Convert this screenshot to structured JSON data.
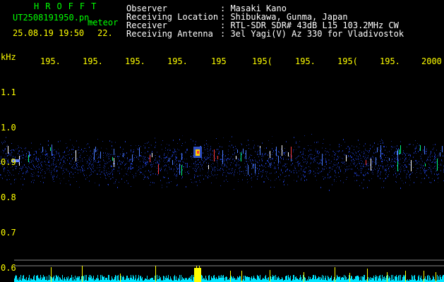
{
  "header": {
    "brand": "HROFFT",
    "filename": "UT2508191950.pn_",
    "meteor_label": "meteor",
    "datetime": "25.08.19 19:50",
    "datetime_seconds": "22.",
    "meta": [
      {
        "label": "Observer",
        "value": ": Masaki Kano"
      },
      {
        "label": "Receiving Location",
        "value": ": Shibukawa, Gunma, Japan"
      },
      {
        "label": "Receiver",
        "value": ": RTL-SDR SDR# 43dB L15 103.2MHz CW"
      },
      {
        "label": "Receiving Antenna",
        "value": ": 3el Yagi(V) Az 330 for Vladivostok"
      }
    ]
  },
  "axes": {
    "y_unit": "kHz",
    "x_ticks": [
      "195.",
      "195.",
      "195.",
      "195.",
      "195",
      "195(",
      "195.",
      "195(",
      "195.",
      "2000"
    ],
    "y_ticks": [
      "1.1",
      "1.0",
      "0.9",
      "0.8",
      "0.7",
      "0.6"
    ]
  },
  "colors": {
    "background": "#000000",
    "axis_label": "#ffff00",
    "brand": "#00ff00",
    "signal_band": "#1e3cb4",
    "meteor_ping": "#ff3a3a",
    "histogram": "#00e5ff",
    "histogram_peak": "#ffff00"
  }
}
